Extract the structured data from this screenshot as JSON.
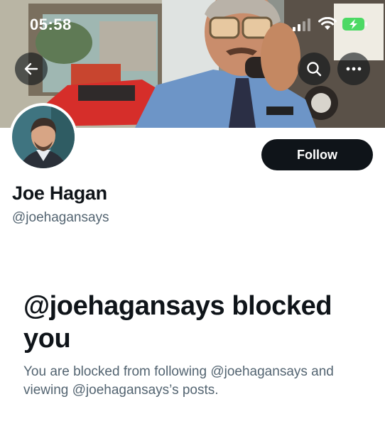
{
  "status_bar": {
    "time": "05:58",
    "icons": [
      "cellular-signal-icon",
      "wifi-icon",
      "battery-charging-icon"
    ],
    "battery_color": "#4cd964"
  },
  "banner": {
    "description_icons": [
      "back-arrow-icon",
      "search-icon",
      "more-icon"
    ]
  },
  "profile": {
    "display_name": "Joe Hagan",
    "handle": "@joehagansays",
    "follow_label": "Follow"
  },
  "blocked_notice": {
    "title": "@joehagansays blocked you",
    "description": "You are blocked from following @joehagansays and viewing @joehagansays’s posts."
  },
  "colors": {
    "text_primary": "#0f1419",
    "text_secondary": "#536471",
    "button_bg": "#0f1419",
    "button_text": "#ffffff"
  }
}
